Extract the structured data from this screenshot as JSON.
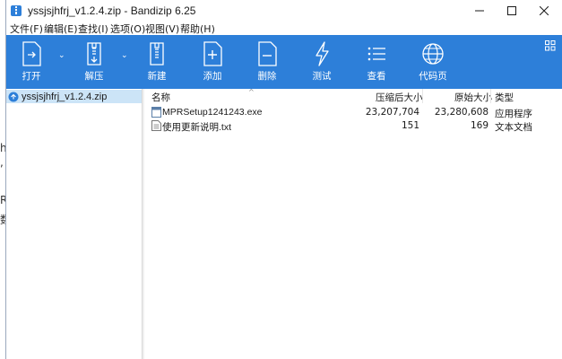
{
  "window": {
    "title": "yssjsjhfrj_v1.2.4.zip - Bandizip 6.25"
  },
  "background_fragments": [
    "h",
    ",",
    "R",
    "数"
  ],
  "menu": [
    {
      "label": "文件(F)"
    },
    {
      "label": "编辑(E)"
    },
    {
      "label": "查找(I)"
    },
    {
      "label": "选项(O)"
    },
    {
      "label": "视图(V)"
    },
    {
      "label": "帮助(H)"
    }
  ],
  "toolbar": {
    "open_label": "打开",
    "extract_label": "解压",
    "new_label": "新建",
    "add_label": "添加",
    "delete_label": "删除",
    "test_label": "测试",
    "view_label": "查看",
    "codepage_label": "代码页"
  },
  "colors": {
    "ribbon": "#2d7fd9",
    "selection": "#cce4f7"
  },
  "tree": {
    "root_label": "yssjsjhfrj_v1.2.4.zip"
  },
  "columns": {
    "name": "名称",
    "packed": "压缩后大小",
    "original": "原始大小",
    "type": "类型"
  },
  "files": [
    {
      "name": "MPRSetup1241243.exe",
      "packed": "23,207,704",
      "original": "23,280,608",
      "type": "应用程序",
      "icon": "exe-file-icon"
    },
    {
      "name": "使用更新说明.txt",
      "packed": "151",
      "original": "169",
      "type": "文本文档",
      "icon": "text-file-icon"
    }
  ]
}
